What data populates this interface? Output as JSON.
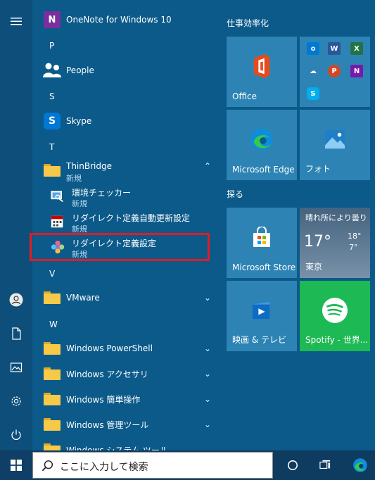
{
  "applist": {
    "onenote_label": "OneNote for Windows 10",
    "letter_p": "P",
    "people_label": "People",
    "letter_s": "S",
    "skype_label": "Skype",
    "letter_t": "T",
    "thinbridge_label": "ThinBridge",
    "thinbridge_sub": "新規",
    "env_checker_label": "環境チェッカー",
    "env_checker_sub": "新規",
    "auto_update_label": "リダイレクト定義自動更新設定",
    "auto_update_sub": "新規",
    "redirect_setting_label": "リダイレクト定義設定",
    "redirect_setting_sub": "新規",
    "letter_v": "V",
    "vmware_label": "VMware",
    "letter_w": "W",
    "powershell_label": "Windows PowerShell",
    "accessories_label": "Windows アクセサリ",
    "ease_label": "Windows 簡単操作",
    "admin_label": "Windows 管理ツール",
    "system_label": "Windows システム ツール"
  },
  "tiles": {
    "group1_title": "仕事効率化",
    "office_label": "Office",
    "edge_label": "Microsoft Edge",
    "photos_label": "フォト",
    "group2_title": "探る",
    "store_label": "Microsoft Store",
    "weather_condition": "晴れ所により曇り",
    "weather_temp": "17°",
    "weather_high": "18°",
    "weather_low": "7°",
    "weather_city": "東京",
    "movies_label": "映画 & テレビ",
    "spotify_label": "Spotify - 世界..."
  },
  "taskbar": {
    "search_placeholder": "ここに入力して検索"
  },
  "colors": {
    "background": "#0b5a8a",
    "tile": "#2d84b4",
    "spotify": "#1db954",
    "highlight": "#e31b23",
    "taskbar": "#0e3b60"
  }
}
